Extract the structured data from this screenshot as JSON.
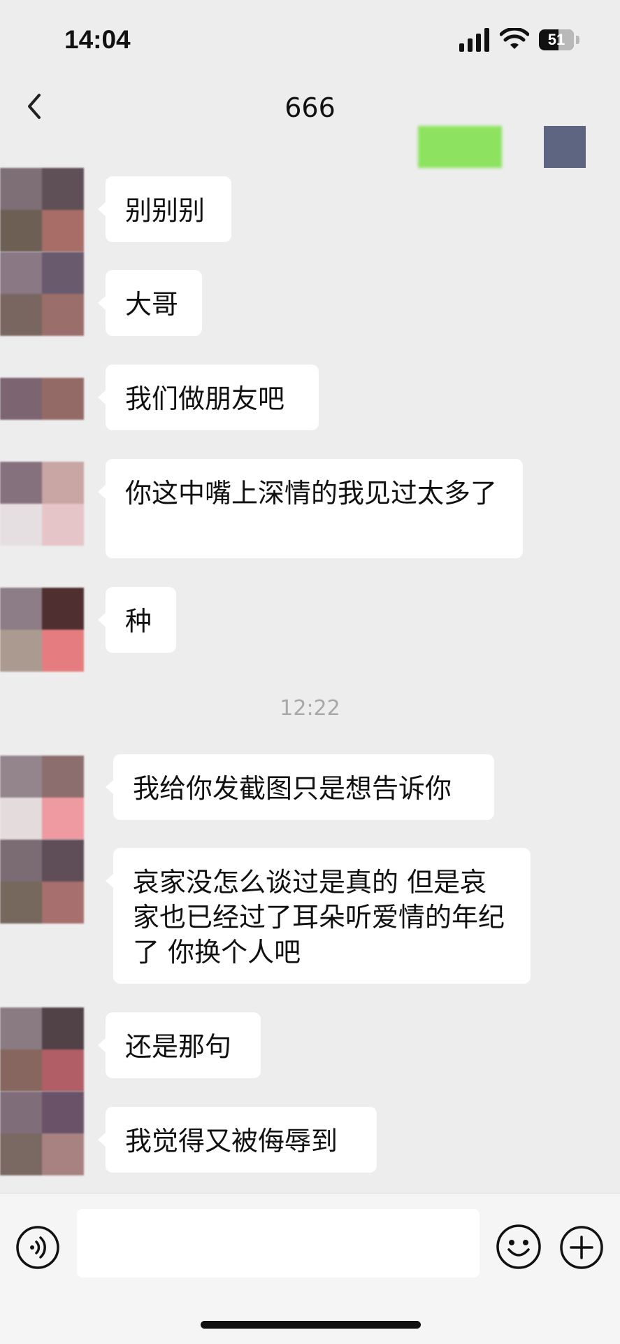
{
  "status_bar": {
    "time": "14:04",
    "battery_level": "51"
  },
  "header": {
    "title": "666"
  },
  "messages": [
    {
      "text": "别别别"
    },
    {
      "text": "大哥"
    },
    {
      "text": "我们做朋友吧"
    },
    {
      "text": "你这中嘴上深情的我见过太多了"
    },
    {
      "text": "种"
    },
    {
      "text": "我给你发截图只是想告诉你"
    },
    {
      "text": "哀家没怎么谈过是真的 但是哀家也已经过了耳朵听爱情的年纪了 你换个人吧"
    },
    {
      "text": "还是那句"
    },
    {
      "text": "我觉得又被侮辱到"
    }
  ],
  "timestamp": "12:22",
  "input_bar": {
    "placeholder": ""
  },
  "icons": {
    "back": "chevron-left-icon",
    "voice": "voice-icon",
    "emoji": "smiley-icon",
    "plus": "plus-icon",
    "signal": "signal-icon",
    "wifi": "wifi-icon",
    "battery": "battery-icon"
  },
  "colors": {
    "background": "#ededed",
    "bubble": "#ffffff",
    "timestamp": "#a8a8a8",
    "obscured_green": "#8de35f",
    "obscured_gray": "#5d6580"
  }
}
